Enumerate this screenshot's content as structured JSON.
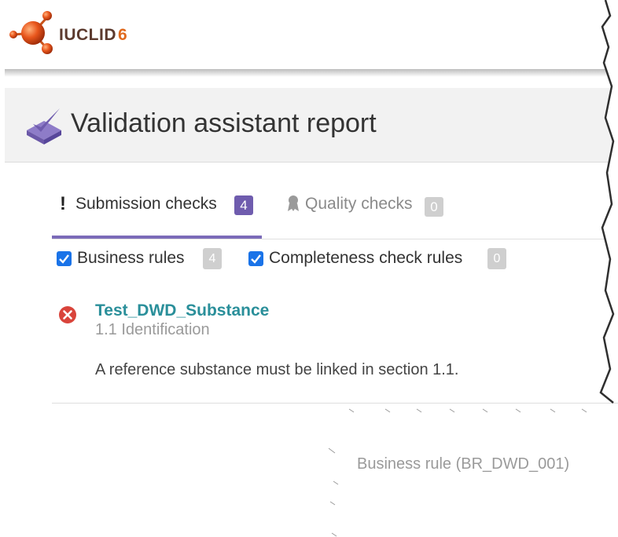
{
  "app": {
    "logo_name": "IUCLID",
    "logo_version": "6"
  },
  "page": {
    "title": "Validation assistant report"
  },
  "tabs": [
    {
      "label": "Submission checks",
      "count": "4",
      "active": true
    },
    {
      "label": "Quality checks",
      "count": "0",
      "active": false
    }
  ],
  "filters": [
    {
      "label": "Business rules",
      "count": "4",
      "checked": true
    },
    {
      "label": "Completeness check rules",
      "count": "0",
      "checked": true
    }
  ],
  "result": {
    "title": "Test_DWD_Substance",
    "section": "1.1 Identification",
    "message": "A reference substance must be linked in section 1.1.",
    "rule": "Business rule (BR_DWD_001)",
    "status_icon": "error-icon"
  },
  "colors": {
    "accent": "#6f5cae",
    "link": "#2a8f9a",
    "error": "#d9443b",
    "checkbox": "#1a73e8",
    "logo_orange": "#e06a1e"
  }
}
